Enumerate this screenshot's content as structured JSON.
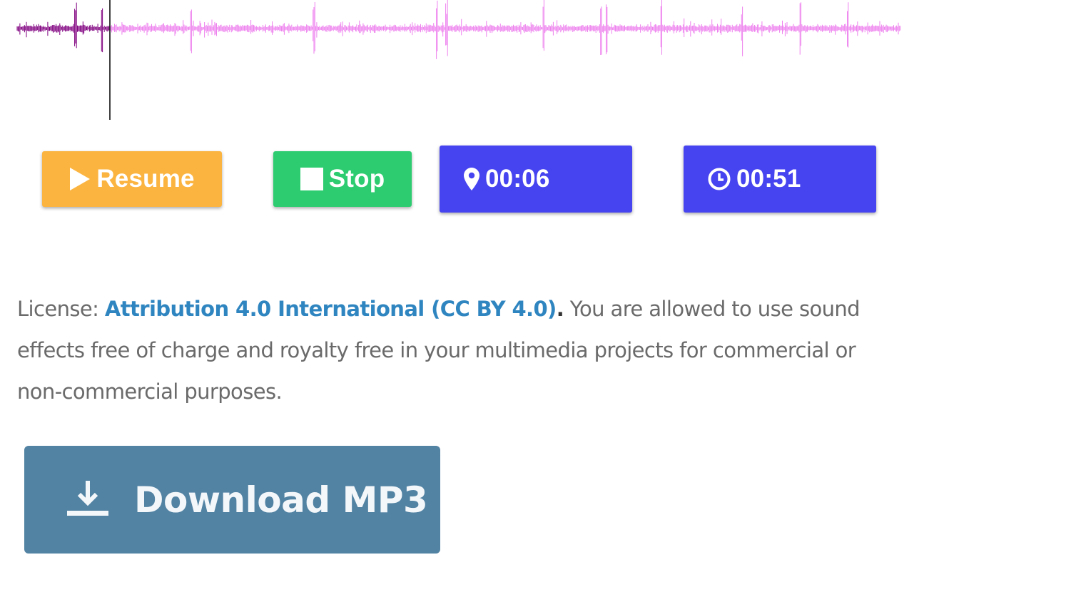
{
  "player": {
    "colors": {
      "played": "#800080",
      "unplayed": "#ee82ee",
      "cursor": "#000000"
    },
    "progress_fraction": 0.105,
    "controls": {
      "resume_label": "Resume",
      "stop_label": "Stop",
      "position_time": "00:06",
      "duration_time": "00:51"
    },
    "button_colors": {
      "resume": "#fbb440",
      "stop": "#2ecc71",
      "time": "#4643f0"
    }
  },
  "license": {
    "prefix": "License: ",
    "link_text": "Attribution 4.0 International (CC BY 4.0)",
    "dot": ".",
    "text": " You are allowed to use sound effects free of charge and royalty free in your multimedia projects for commercial or non-commercial purposes."
  },
  "download": {
    "label": "Download MP3",
    "icon": "download-icon",
    "color": "#5283a3"
  }
}
